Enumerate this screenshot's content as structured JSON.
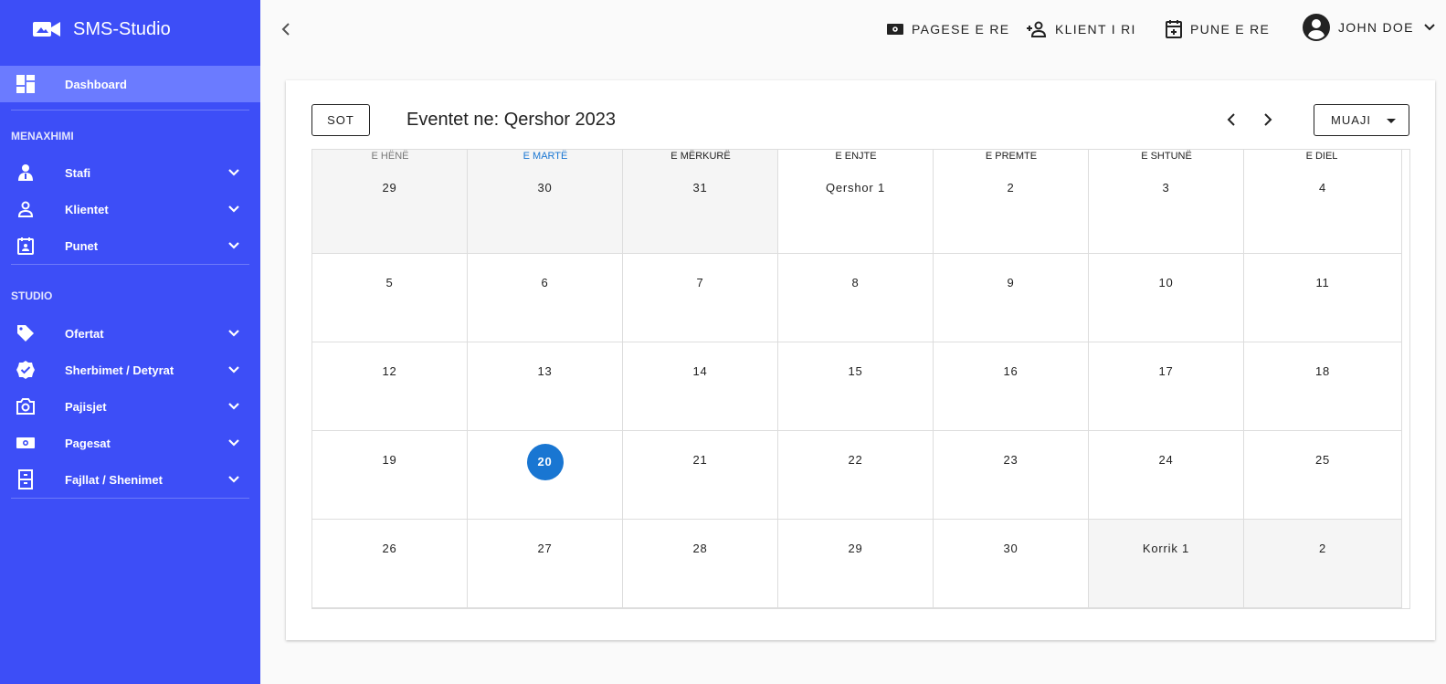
{
  "app": {
    "title": "SMS-Studio"
  },
  "sidebar": {
    "dashboard": "Dashboard",
    "sections": [
      "MENAXHIMI",
      "STUDIO"
    ],
    "items": [
      {
        "label": "Stafi",
        "icon": "staff-icon"
      },
      {
        "label": "Klientet",
        "icon": "person-icon"
      },
      {
        "label": "Punet",
        "icon": "calendar-person-icon"
      },
      {
        "label": "Ofertat",
        "icon": "tag-icon"
      },
      {
        "label": "Sherbimet / Detyrat",
        "icon": "verified-icon"
      },
      {
        "label": "Pajisjet",
        "icon": "camera-icon"
      },
      {
        "label": "Pagesat",
        "icon": "money-icon"
      },
      {
        "label": "Fajllat / Shenimet",
        "icon": "file-cabinet-icon"
      }
    ]
  },
  "topbar": {
    "new_payment": "PAGESE E RE",
    "new_client": "KLIENT I RI",
    "new_job": "PUNE E RE",
    "user": "JOHN DOE"
  },
  "calendar": {
    "today_button": "SOT",
    "title": "Eventet ne: Qershor 2023",
    "view_button": "MUAJI",
    "weekdays": [
      "E HËNË",
      "E MARTË",
      "E MËRKURË",
      "E ENJTE",
      "E PREMTE",
      "E SHTUNË",
      "E DIEL"
    ],
    "weeks": [
      [
        "29",
        "30",
        "31",
        "Qershor 1",
        "2",
        "3",
        "4"
      ],
      [
        "5",
        "6",
        "7",
        "8",
        "9",
        "10",
        "11"
      ],
      [
        "12",
        "13",
        "14",
        "15",
        "16",
        "17",
        "18"
      ],
      [
        "19",
        "20",
        "21",
        "22",
        "23",
        "24",
        "25"
      ],
      [
        "26",
        "27",
        "28",
        "29",
        "30",
        "Korrik 1",
        "2"
      ]
    ],
    "today": "20",
    "colors": {
      "today": "#1976d2",
      "sidebar": "#3d4ef7",
      "sidebar_active": "#6b7bff"
    }
  }
}
